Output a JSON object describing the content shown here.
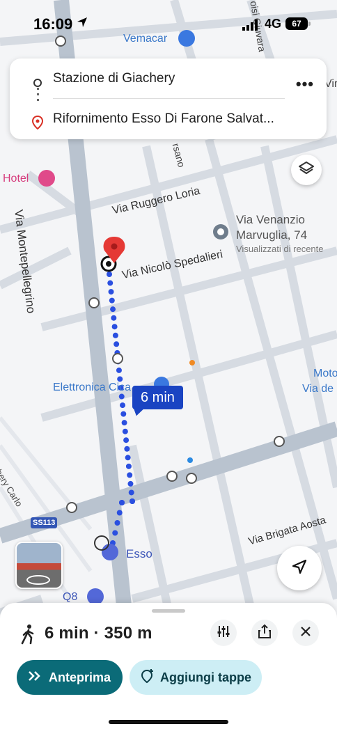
{
  "status_bar": {
    "time": "16:09",
    "network": "4G",
    "battery": "67"
  },
  "route": {
    "origin": "Stazione di Giachery",
    "destination": "Rifornimento Esso Di Farone Salvat...",
    "more_label": "•••"
  },
  "map": {
    "streets": {
      "via_montepellegrino": "Via Montepellegrino",
      "via_ruggero_loria": "Via Ruggero Loria",
      "via_nicolo_spedalieri": "Via Nicolò Spedalieri",
      "via_brigata_aosta": "Via Brigata Aosta",
      "sarsano": "rsano",
      "isi_giuvara": "oisi Giuvara",
      "chery_carlo": "chery Carlo",
      "via_de": "Via de",
      "mot": "Moto",
      "via_r": "Vir"
    },
    "places": {
      "vemacar": "Vemacar",
      "hotel": "Hotel",
      "elettronica": "Elettronica Cica",
      "esso": "Esso",
      "q8": "Q8",
      "saved_place_title_1": "Via Venanzio",
      "saved_place_title_2": "Marvuglia, 74",
      "saved_place_sub": "Visualizzati di recente"
    },
    "road_shield": "SS113",
    "eta_label": "6 min"
  },
  "sheet": {
    "summary": "6 min · 350 m",
    "preview_label": "Anteprima",
    "add_stops_label": "Aggiungi tappe"
  },
  "colors": {
    "accent_blue": "#1a44c2",
    "route_dot": "#2a4fe0",
    "pin_red": "#e53935",
    "teal": "#0b6b78",
    "light_teal": "#cdeef5"
  },
  "icons": [
    "location-arrow-icon",
    "signal-icon",
    "pin-icon",
    "swap-icon",
    "layers-icon",
    "compass-icon",
    "walk-icon",
    "filters-icon",
    "share-icon",
    "close-icon",
    "fast-forward-icon",
    "add-stop-icon",
    "bus-stop-icon",
    "fuel-icon",
    "hotel-icon"
  ]
}
